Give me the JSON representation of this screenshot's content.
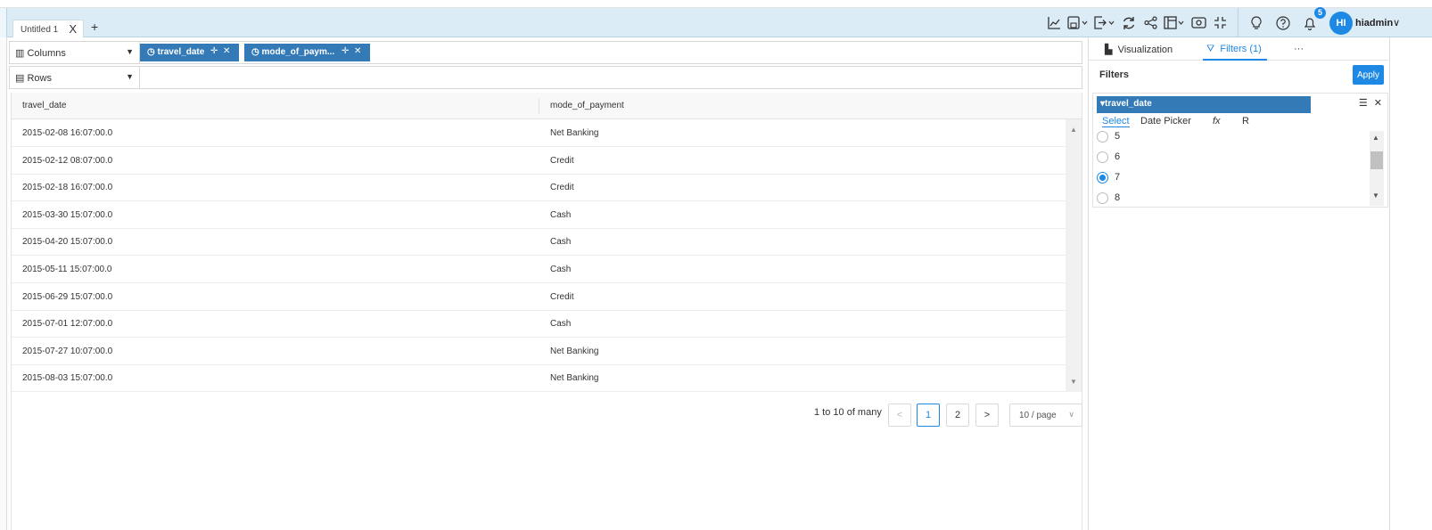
{
  "tabs": {
    "active_label": "Untitled 1",
    "close": "X",
    "add": "+"
  },
  "toolbar": {
    "icons": [
      "line-chart-icon",
      "save-icon",
      "export-icon",
      "refresh-icon",
      "share-icon",
      "layout-icon",
      "preview-icon",
      "fullscreen-icon",
      "bulb-icon",
      "help-icon",
      "bell-icon"
    ],
    "notifications": "5",
    "avatar_initials": "HI",
    "username": "hiadmin"
  },
  "shelves": {
    "columns_label": "Columns",
    "rows_label": "Rows",
    "pills": [
      {
        "label": "travel_date"
      },
      {
        "label": "mode_of_paym..."
      }
    ]
  },
  "grid": {
    "headers": [
      "travel_date",
      "mode_of_payment"
    ],
    "rows": [
      [
        "2015-02-08 16:07:00.0",
        "Net Banking"
      ],
      [
        "2015-02-12 08:07:00.0",
        "Credit"
      ],
      [
        "2015-02-18 16:07:00.0",
        "Credit"
      ],
      [
        "2015-03-30 15:07:00.0",
        "Cash"
      ],
      [
        "2015-04-20 15:07:00.0",
        "Cash"
      ],
      [
        "2015-05-11 15:07:00.0",
        "Cash"
      ],
      [
        "2015-06-29 15:07:00.0",
        "Credit"
      ],
      [
        "2015-07-01 12:07:00.0",
        "Cash"
      ],
      [
        "2015-07-27 10:07:00.0",
        "Net Banking"
      ],
      [
        "2015-08-03 15:07:00.0",
        "Net Banking"
      ]
    ]
  },
  "pagination": {
    "summary": "1 to 10 of many",
    "prev": "<",
    "pages": [
      "1",
      "2"
    ],
    "next": ">",
    "page_size": "10 / page"
  },
  "panel": {
    "tab_visualization": "Visualization",
    "tab_filters": "Filters (1)",
    "more": "···",
    "filters_title": "Filters",
    "apply_label": "Apply",
    "filter_field": "travel_date",
    "filter_tabs": [
      "Select",
      "Date Picker",
      "fx",
      "R"
    ],
    "options": [
      {
        "label": "5",
        "checked": false
      },
      {
        "label": "6",
        "checked": false
      },
      {
        "label": "7",
        "checked": true
      },
      {
        "label": "8",
        "checked": false
      }
    ]
  }
}
